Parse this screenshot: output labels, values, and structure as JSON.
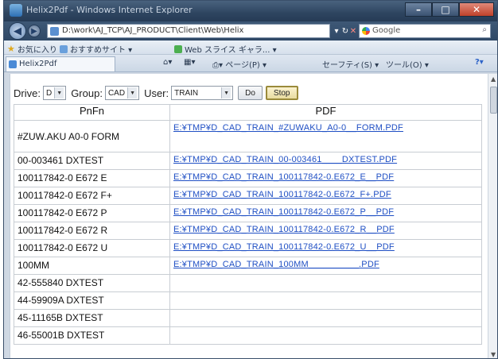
{
  "browser": {
    "window_title": "Helix2Pdf - Windows Internet Explorer",
    "address": "D:\\work\\AJ_TCP\\AJ_PRODUCT\\Client\\Web\\Helix",
    "search_placeholder": "Google",
    "favorites": [
      "お気に入り",
      "おすすめサイト ▾",
      "Web スライス ギャラ... ▾"
    ],
    "tab_title": "Helix2Pdf",
    "command_items": [
      "▾",
      "▾",
      "▾ ページ(P) ▾",
      "セーフティ(S) ▾",
      "ツール(O) ▾"
    ]
  },
  "toolbar": {
    "drive_label": "Drive:",
    "drive_value": "D",
    "group_label": "Group:",
    "group_value": "CAD",
    "user_label": "User:",
    "user_value": "TRAIN",
    "do_label": "Do",
    "stop_label": "Stop"
  },
  "table": {
    "headers": [
      "PnFn",
      "PDF"
    ],
    "rows": [
      {
        "pnfn": "#ZUW.AKU A0-0 FORM",
        "pdf": "E:¥TMP¥D_CAD_TRAIN_#ZUWAKU_A0-0__FORM.PDF"
      },
      {
        "pnfn": "00-003461 DXTEST",
        "pdf": "E:¥TMP¥D_CAD_TRAIN_00-003461____DXTEST.PDF"
      },
      {
        "pnfn": "100117842-0 E672 E",
        "pdf": "E:¥TMP¥D_CAD_TRAIN_100117842-0.E672_E__PDF"
      },
      {
        "pnfn": "100117842-0 E672 F+",
        "pdf": "E:¥TMP¥D_CAD_TRAIN_100117842-0.E672_F+.PDF"
      },
      {
        "pnfn": "100117842-0 E672 P",
        "pdf": "E:¥TMP¥D_CAD_TRAIN_100117842-0.E672_P__PDF"
      },
      {
        "pnfn": "100117842-0 E672 R",
        "pdf": "E:¥TMP¥D_CAD_TRAIN_100117842-0.E672_R__PDF"
      },
      {
        "pnfn": "100117842-0 E672 U",
        "pdf": "E:¥TMP¥D_CAD_TRAIN_100117842-0.E672_U__PDF"
      },
      {
        "pnfn": "100MM",
        "pdf": "E:¥TMP¥D_CAD_TRAIN_100MM__________.PDF"
      },
      {
        "pnfn": "42-555840 DXTEST",
        "pdf": ""
      },
      {
        "pnfn": "44-59909A DXTEST",
        "pdf": ""
      },
      {
        "pnfn": "45-11165B DXTEST",
        "pdf": ""
      },
      {
        "pnfn": "46-55001B DXTEST",
        "pdf": ""
      }
    ]
  },
  "colors": {
    "link": "#1f4fc4",
    "titlebar": "#2e4560",
    "stop_button_border": "#9a8a3a"
  },
  "icons": [
    "back-arrow-icon",
    "forward-arrow-icon",
    "refresh-icon",
    "close-icon",
    "google-icon",
    "search-icon",
    "favorites-star-icon",
    "home-icon",
    "help-icon"
  ]
}
